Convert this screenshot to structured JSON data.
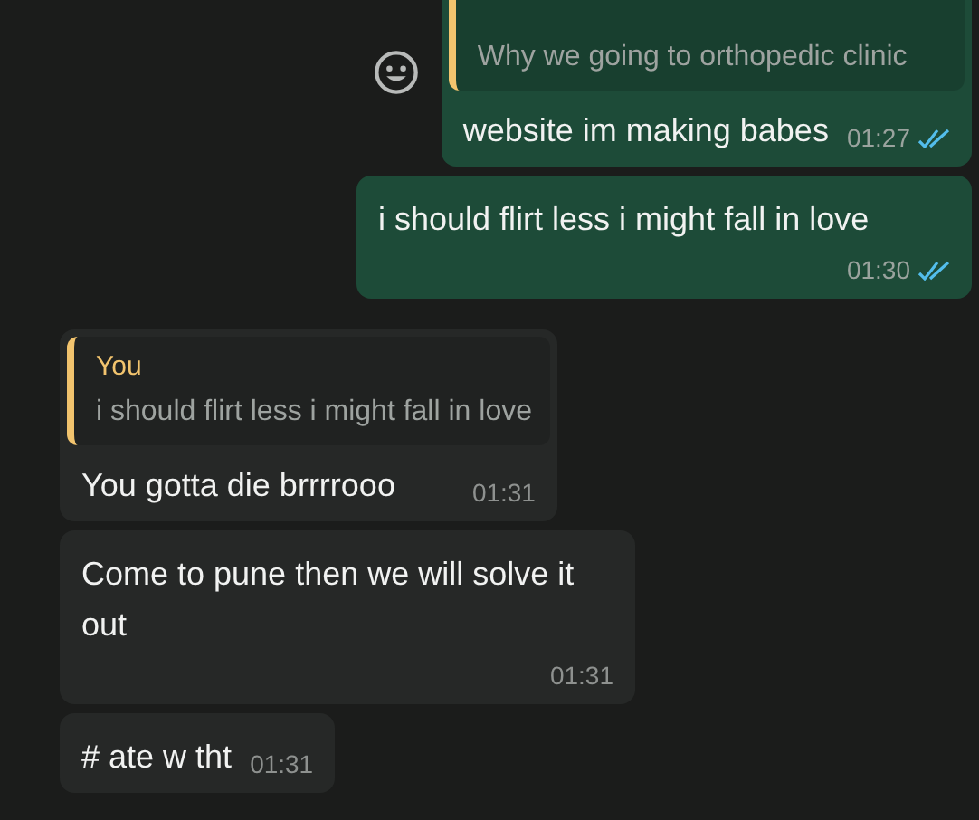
{
  "messages": [
    {
      "kind": "outgoing",
      "reaction_button": true,
      "quote": {
        "text": "Why we going to orthopedic clinic"
      },
      "text": "website im making babes",
      "time": "01:27",
      "read": true
    },
    {
      "kind": "outgoing",
      "reaction_button": false,
      "text": "i should flirt less i might fall in love",
      "time": "01:30",
      "read": true
    },
    {
      "kind": "incoming",
      "reaction_button": false,
      "quote": {
        "author": "You",
        "text": "i should flirt less i might fall in love"
      },
      "text": "You gotta die brrrrooo",
      "time": "01:31"
    },
    {
      "kind": "incoming",
      "reaction_button": false,
      "text": "Come to pune then we will solve it out",
      "time": "01:31"
    },
    {
      "kind": "incoming",
      "reaction_button": false,
      "text": "# ate w tht",
      "time": "01:31"
    }
  ]
}
